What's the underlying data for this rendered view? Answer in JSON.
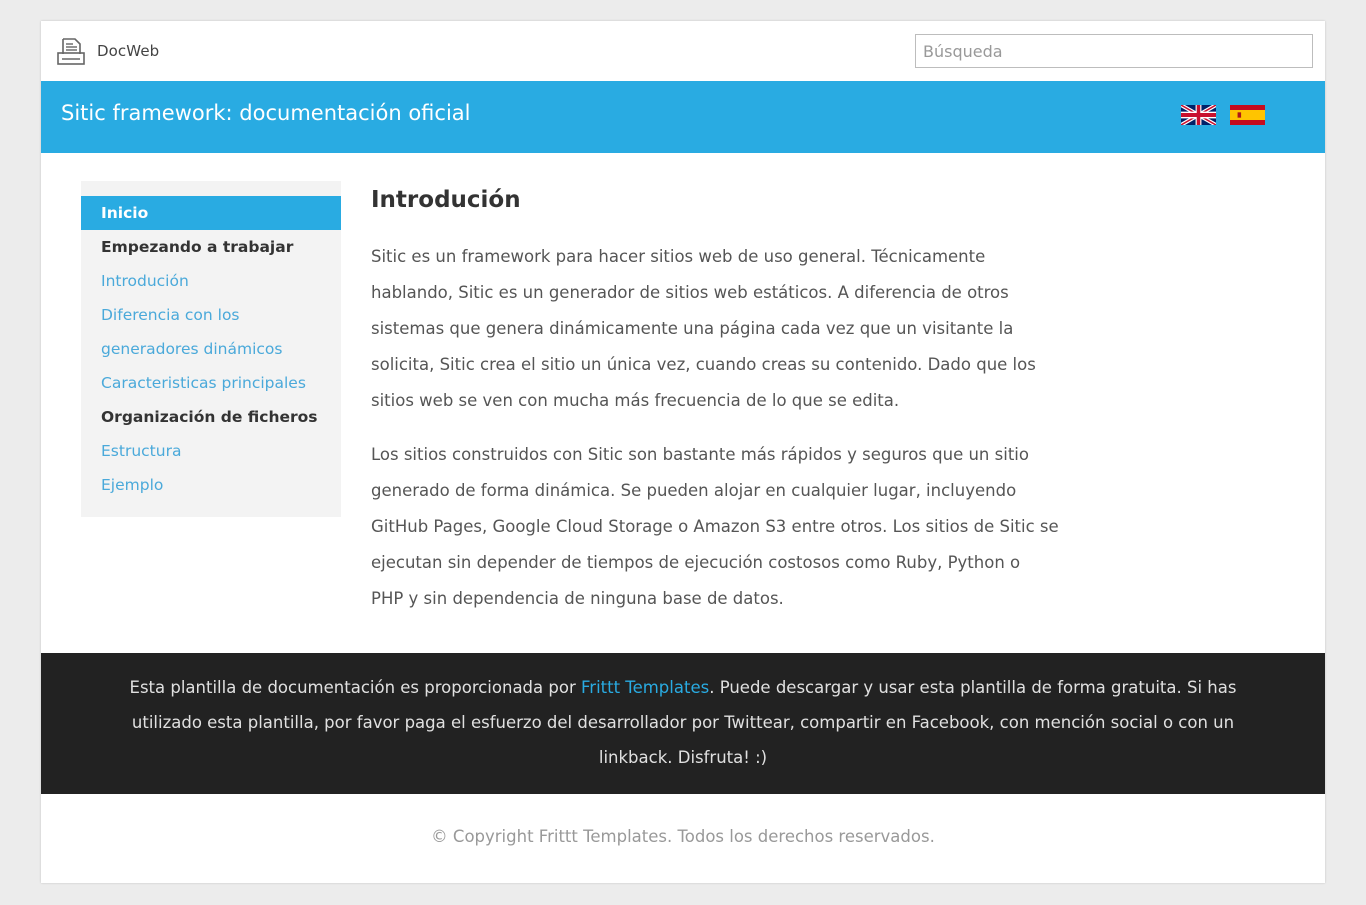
{
  "topbar": {
    "brand": "DocWeb",
    "brand_icon": "printer-icon",
    "search_placeholder": "Búsqueda"
  },
  "header": {
    "title": "Sitic framework: documentación oficial",
    "flags": [
      {
        "name": "flag-uk-icon"
      },
      {
        "name": "flag-spain-icon"
      }
    ],
    "color": "#29abe2"
  },
  "sidebar": {
    "items": [
      {
        "label": "Inicio",
        "type": "active"
      },
      {
        "label": "Empezando a trabajar",
        "type": "header"
      },
      {
        "label": "Introdución",
        "type": "link"
      },
      {
        "label": "Diferencia con los",
        "type": "link"
      },
      {
        "label": "generadores dinámicos",
        "type": "link"
      },
      {
        "label": "Caracteristicas principales",
        "type": "link"
      },
      {
        "label": "Organización de ficheros",
        "type": "header"
      },
      {
        "label": "Estructura",
        "type": "link"
      },
      {
        "label": "Ejemplo",
        "type": "link"
      }
    ]
  },
  "main": {
    "heading": "Introdución",
    "p1": [
      "Sitic es un framework para hacer sitios web de uso general. Técnicamente",
      "hablando, Sitic es un generador de sitios web estáticos. A diferencia de otros",
      "sistemas que genera dinámicamente una página cada vez que un visitante la",
      "solicita, Sitic crea el sitio un única vez, cuando creas su contenido. Dado que los",
      "sitios web se ven con mucha más frecuencia de lo que se edita."
    ],
    "p2": [
      "Los sitios construidos con Sitic son bastante más rápidos y seguros que un sitio",
      "generado de forma dinámica. Se pueden alojar en cualquier lugar, incluyendo",
      "GitHub Pages, Google Cloud Storage o Amazon S3 entre otros. Los sitios de Sitic se",
      "ejecutan sin depender de tiempos de ejecución costosos como Ruby, Python o",
      "PHP y sin dependencia de ninguna base de datos."
    ]
  },
  "footer": {
    "line1_before": "Esta plantilla de documentación es proporcionada por ",
    "link": "Frittt Templates",
    "line1_after": ". Puede descargar y usar esta plantilla de forma gratuita. Si has",
    "line2": "utilizado esta plantilla, por favor paga el esfuerzo del desarrollador por Twittear, compartir en Facebook, con mención social o con un",
    "line3": "linkback. Disfruta! :)",
    "copyright": "© Copyright Frittt Templates. Todos los derechos reservados."
  }
}
